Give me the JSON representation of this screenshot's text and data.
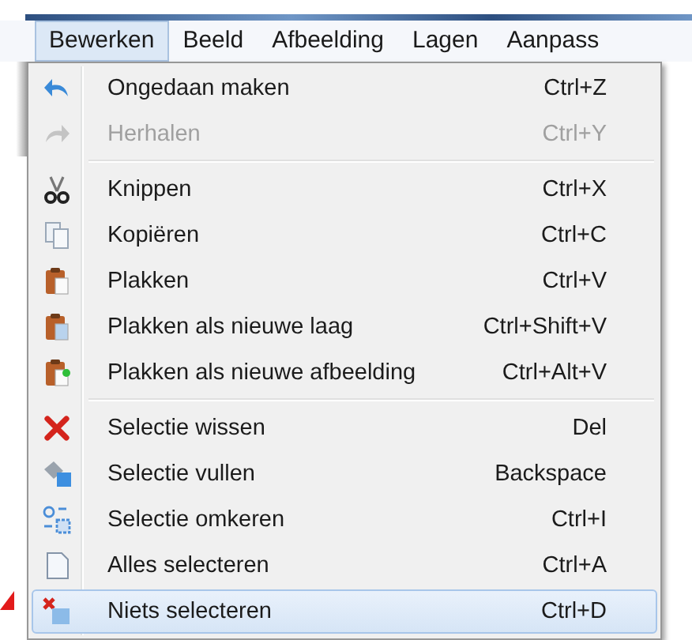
{
  "menubar": [
    {
      "label": "Bewerken",
      "selected": true
    },
    {
      "label": "Beeld",
      "selected": false
    },
    {
      "label": "Afbeelding",
      "selected": false
    },
    {
      "label": "Lagen",
      "selected": false
    },
    {
      "label": "Aanpass",
      "selected": false
    }
  ],
  "menu": {
    "groups": [
      [
        {
          "label": "Ongedaan maken",
          "shortcut": "Ctrl+Z",
          "disabled": false,
          "selected": false
        },
        {
          "label": "Herhalen",
          "shortcut": "Ctrl+Y",
          "disabled": true,
          "selected": false
        }
      ],
      [
        {
          "label": "Knippen",
          "shortcut": "Ctrl+X",
          "disabled": false,
          "selected": false
        },
        {
          "label": "Kopiëren",
          "shortcut": "Ctrl+C",
          "disabled": false,
          "selected": false
        },
        {
          "label": "Plakken",
          "shortcut": "Ctrl+V",
          "disabled": false,
          "selected": false
        },
        {
          "label": "Plakken als nieuwe laag",
          "shortcut": "Ctrl+Shift+V",
          "disabled": false,
          "selected": false
        },
        {
          "label": "Plakken als nieuwe afbeelding",
          "shortcut": "Ctrl+Alt+V",
          "disabled": false,
          "selected": false
        }
      ],
      [
        {
          "label": "Selectie wissen",
          "shortcut": "Del",
          "disabled": false,
          "selected": false
        },
        {
          "label": "Selectie vullen",
          "shortcut": "Backspace",
          "disabled": false,
          "selected": false
        },
        {
          "label": "Selectie omkeren",
          "shortcut": "Ctrl+I",
          "disabled": false,
          "selected": false
        },
        {
          "label": "Alles selecteren",
          "shortcut": "Ctrl+A",
          "disabled": false,
          "selected": false
        },
        {
          "label": "Niets selecteren",
          "shortcut": "Ctrl+D",
          "disabled": false,
          "selected": true
        }
      ]
    ]
  }
}
